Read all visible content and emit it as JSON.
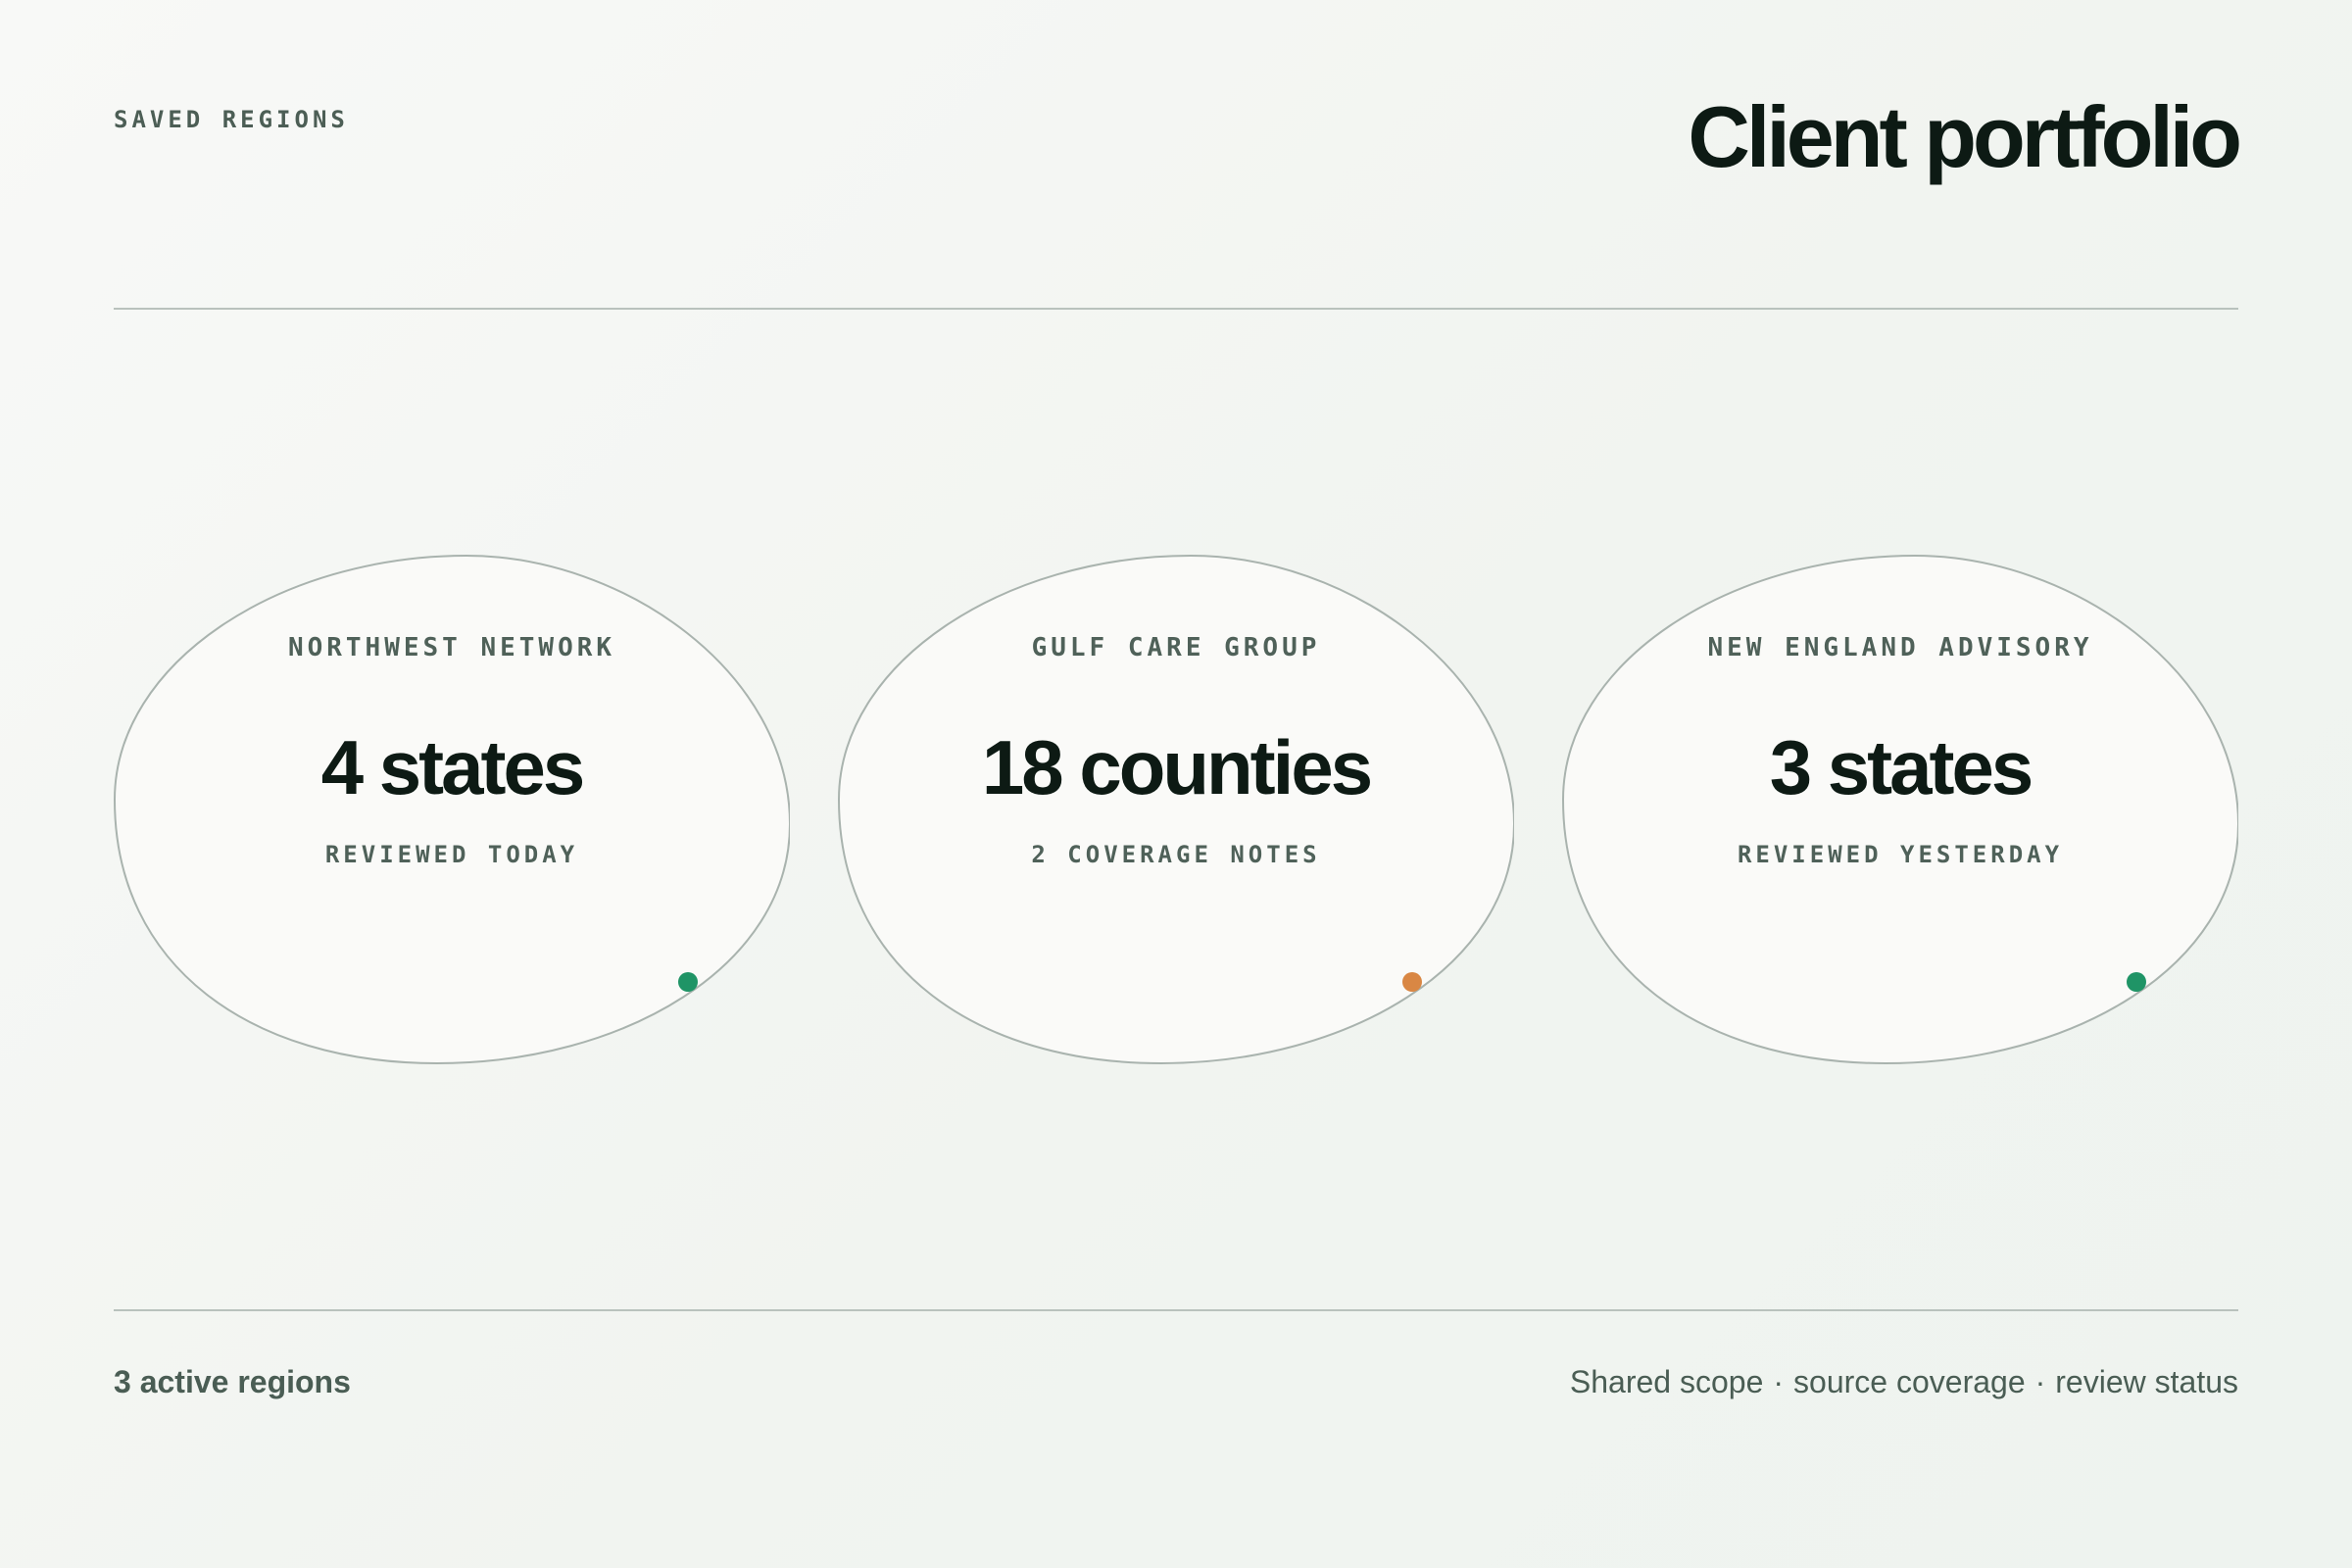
{
  "header": {
    "eyebrow": "SAVED REGIONS",
    "title": "Client portfolio"
  },
  "regions": [
    {
      "name": "NORTHWEST NETWORK",
      "value": "4 states",
      "note": "REVIEWED TODAY",
      "status_color": "#1f9466"
    },
    {
      "name": "GULF CARE GROUP",
      "value": "18 counties",
      "note": "2 COVERAGE NOTES",
      "status_color": "#d98744"
    },
    {
      "name": "NEW ENGLAND ADVISORY",
      "value": "3 states",
      "note": "REVIEWED YESTERDAY",
      "status_color": "#1f9466"
    }
  ],
  "footer": {
    "count": "3 active regions",
    "meta": [
      "Shared scope",
      "source coverage",
      "review status"
    ],
    "separator": "·"
  },
  "colors": {
    "card_fill": "#fafaf8",
    "card_stroke": "#a9b3ae",
    "text_primary": "#0d1a14",
    "text_muted": "#4f6159"
  }
}
